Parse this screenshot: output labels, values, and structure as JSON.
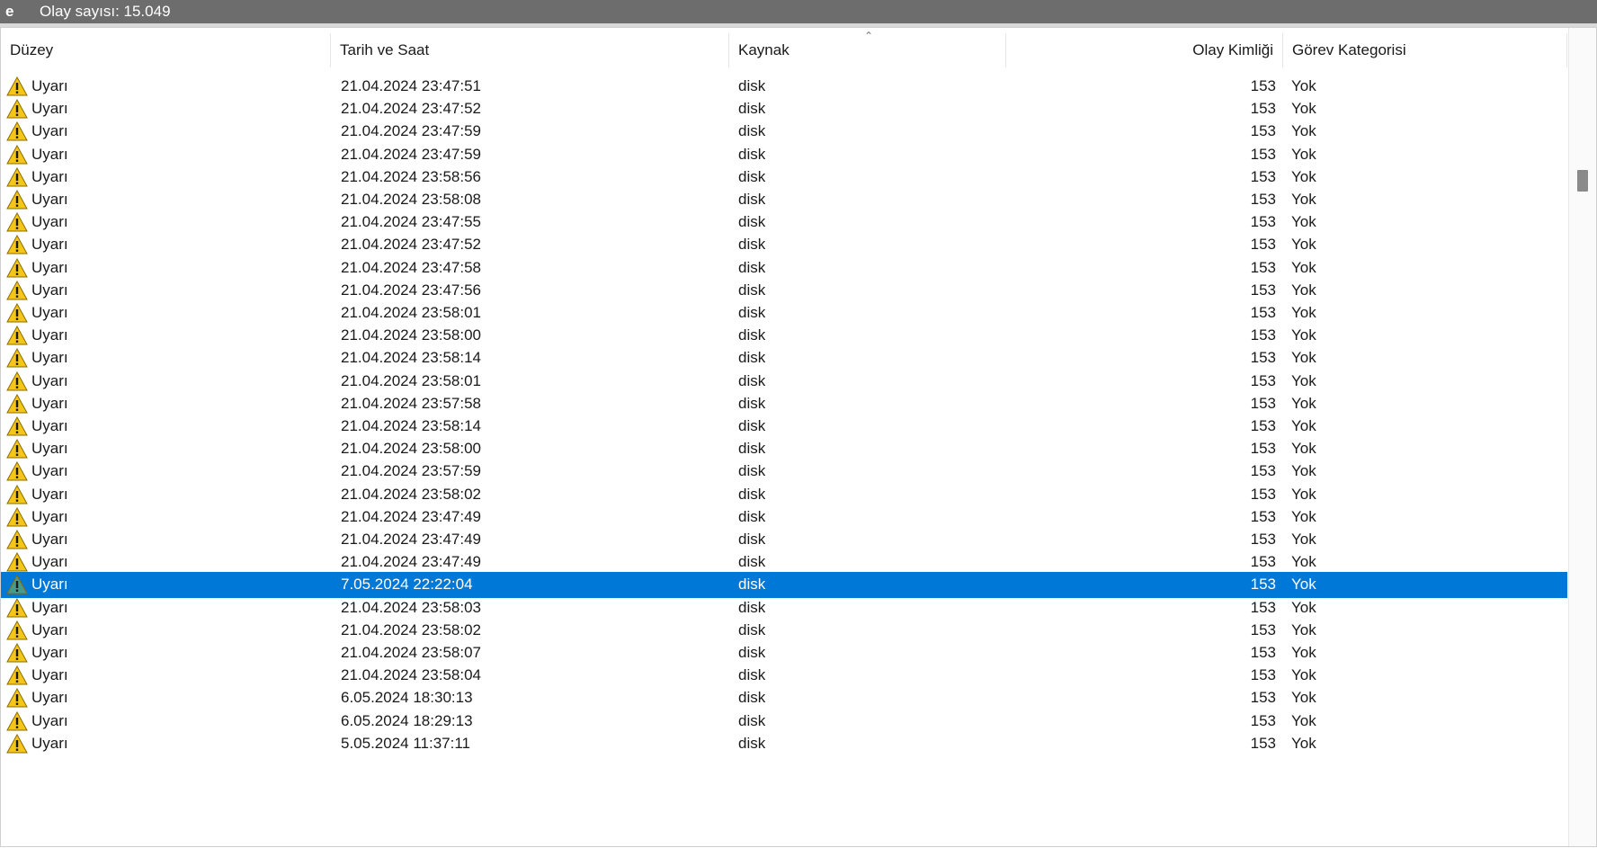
{
  "topbar": {
    "e_label": "e",
    "event_count": "Olay sayısı: 15.049"
  },
  "columns": {
    "level": "Düzey",
    "datetime": "Tarih ve Saat",
    "source": "Kaynak",
    "event_id": "Olay Kimliği",
    "task_category": "Görev Kategorisi"
  },
  "sort": {
    "column": "source",
    "direction": "ascending"
  },
  "selected_index": 22,
  "colors": {
    "selection": "#0078d7",
    "warning": "#f5c518",
    "topbar": "#6d6d6d"
  },
  "rows": [
    {
      "level": "Uyarı",
      "datetime": "21.04.2024 23:47:51",
      "source": "disk",
      "event_id": "153",
      "task_category": "Yok"
    },
    {
      "level": "Uyarı",
      "datetime": "21.04.2024 23:47:52",
      "source": "disk",
      "event_id": "153",
      "task_category": "Yok"
    },
    {
      "level": "Uyarı",
      "datetime": "21.04.2024 23:47:59",
      "source": "disk",
      "event_id": "153",
      "task_category": "Yok"
    },
    {
      "level": "Uyarı",
      "datetime": "21.04.2024 23:47:59",
      "source": "disk",
      "event_id": "153",
      "task_category": "Yok"
    },
    {
      "level": "Uyarı",
      "datetime": "21.04.2024 23:58:56",
      "source": "disk",
      "event_id": "153",
      "task_category": "Yok"
    },
    {
      "level": "Uyarı",
      "datetime": "21.04.2024 23:58:08",
      "source": "disk",
      "event_id": "153",
      "task_category": "Yok"
    },
    {
      "level": "Uyarı",
      "datetime": "21.04.2024 23:47:55",
      "source": "disk",
      "event_id": "153",
      "task_category": "Yok"
    },
    {
      "level": "Uyarı",
      "datetime": "21.04.2024 23:47:52",
      "source": "disk",
      "event_id": "153",
      "task_category": "Yok"
    },
    {
      "level": "Uyarı",
      "datetime": "21.04.2024 23:47:58",
      "source": "disk",
      "event_id": "153",
      "task_category": "Yok"
    },
    {
      "level": "Uyarı",
      "datetime": "21.04.2024 23:47:56",
      "source": "disk",
      "event_id": "153",
      "task_category": "Yok"
    },
    {
      "level": "Uyarı",
      "datetime": "21.04.2024 23:58:01",
      "source": "disk",
      "event_id": "153",
      "task_category": "Yok"
    },
    {
      "level": "Uyarı",
      "datetime": "21.04.2024 23:58:00",
      "source": "disk",
      "event_id": "153",
      "task_category": "Yok"
    },
    {
      "level": "Uyarı",
      "datetime": "21.04.2024 23:58:14",
      "source": "disk",
      "event_id": "153",
      "task_category": "Yok"
    },
    {
      "level": "Uyarı",
      "datetime": "21.04.2024 23:58:01",
      "source": "disk",
      "event_id": "153",
      "task_category": "Yok"
    },
    {
      "level": "Uyarı",
      "datetime": "21.04.2024 23:57:58",
      "source": "disk",
      "event_id": "153",
      "task_category": "Yok"
    },
    {
      "level": "Uyarı",
      "datetime": "21.04.2024 23:58:14",
      "source": "disk",
      "event_id": "153",
      "task_category": "Yok"
    },
    {
      "level": "Uyarı",
      "datetime": "21.04.2024 23:58:00",
      "source": "disk",
      "event_id": "153",
      "task_category": "Yok"
    },
    {
      "level": "Uyarı",
      "datetime": "21.04.2024 23:57:59",
      "source": "disk",
      "event_id": "153",
      "task_category": "Yok"
    },
    {
      "level": "Uyarı",
      "datetime": "21.04.2024 23:58:02",
      "source": "disk",
      "event_id": "153",
      "task_category": "Yok"
    },
    {
      "level": "Uyarı",
      "datetime": "21.04.2024 23:47:49",
      "source": "disk",
      "event_id": "153",
      "task_category": "Yok"
    },
    {
      "level": "Uyarı",
      "datetime": "21.04.2024 23:47:49",
      "source": "disk",
      "event_id": "153",
      "task_category": "Yok"
    },
    {
      "level": "Uyarı",
      "datetime": "21.04.2024 23:47:49",
      "source": "disk",
      "event_id": "153",
      "task_category": "Yok"
    },
    {
      "level": "Uyarı",
      "datetime": "7.05.2024 22:22:04",
      "source": "disk",
      "event_id": "153",
      "task_category": "Yok"
    },
    {
      "level": "Uyarı",
      "datetime": "21.04.2024 23:58:03",
      "source": "disk",
      "event_id": "153",
      "task_category": "Yok"
    },
    {
      "level": "Uyarı",
      "datetime": "21.04.2024 23:58:02",
      "source": "disk",
      "event_id": "153",
      "task_category": "Yok"
    },
    {
      "level": "Uyarı",
      "datetime": "21.04.2024 23:58:07",
      "source": "disk",
      "event_id": "153",
      "task_category": "Yok"
    },
    {
      "level": "Uyarı",
      "datetime": "21.04.2024 23:58:04",
      "source": "disk",
      "event_id": "153",
      "task_category": "Yok"
    },
    {
      "level": "Uyarı",
      "datetime": "6.05.2024 18:30:13",
      "source": "disk",
      "event_id": "153",
      "task_category": "Yok"
    },
    {
      "level": "Uyarı",
      "datetime": "6.05.2024 18:29:13",
      "source": "disk",
      "event_id": "153",
      "task_category": "Yok"
    },
    {
      "level": "Uyarı",
      "datetime": "5.05.2024 11:37:11",
      "source": "disk",
      "event_id": "153",
      "task_category": "Yok"
    }
  ]
}
